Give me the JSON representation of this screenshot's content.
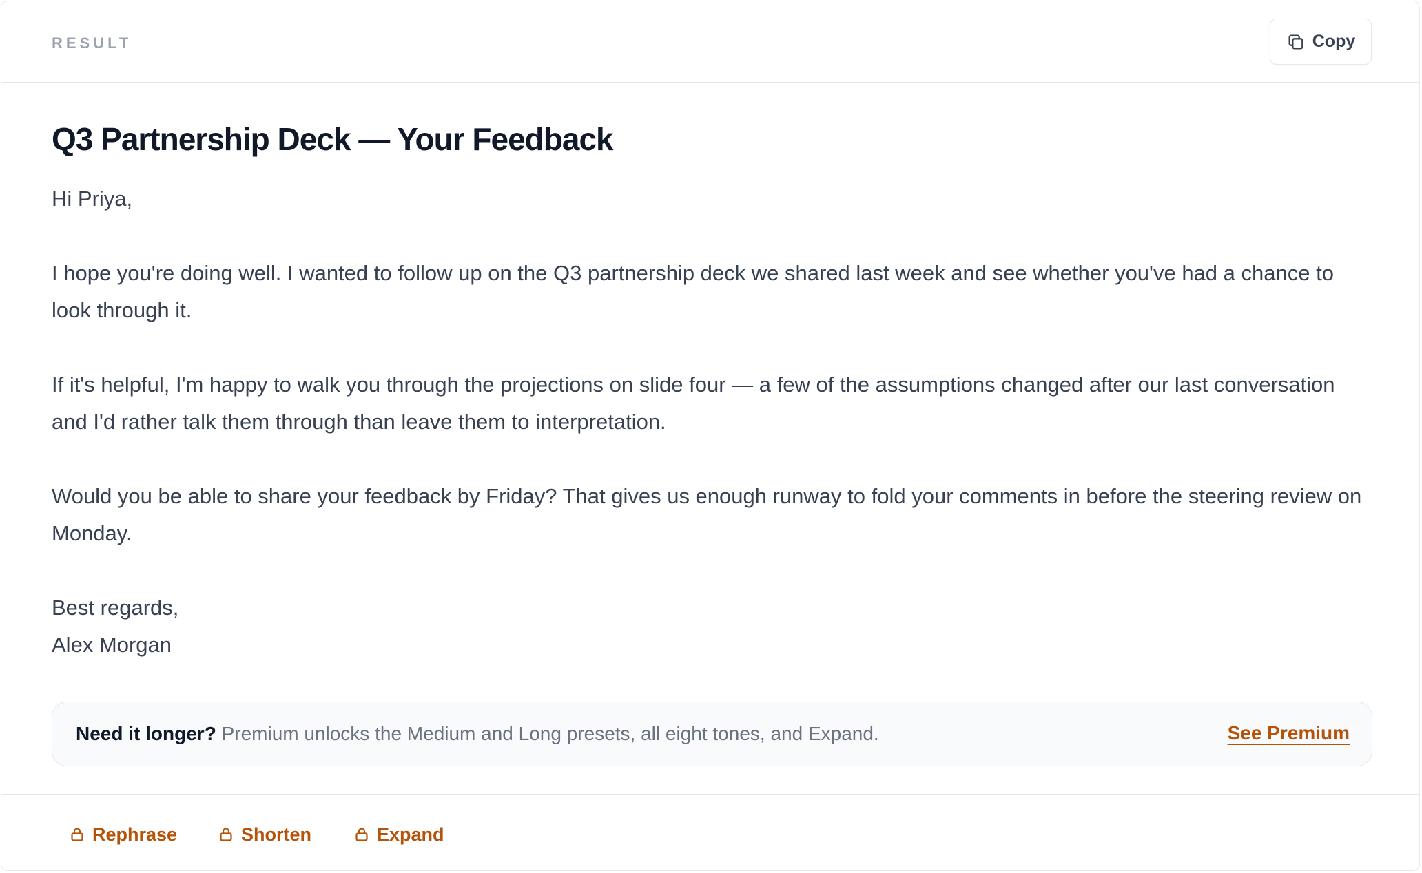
{
  "header": {
    "label": "RESULT",
    "copy_label": "Copy"
  },
  "email": {
    "title": "Q3 Partnership Deck — Your Feedback",
    "greeting": "Hi Priya,",
    "paragraphs": [
      "I hope you're doing well. I wanted to follow up on the Q3 partnership deck we shared last week and see whether you've had a chance to look through it.",
      "If it's helpful, I'm happy to walk you through the projections on slide four — a few of the assumptions changed after our last conversation and I'd rather talk them through than leave them to interpretation.",
      "Would you be able to share your feedback by Friday? That gives us enough runway to fold your comments in before the steering review on Monday."
    ],
    "closing": "Best regards,",
    "signature": "Alex Morgan"
  },
  "upsell": {
    "heading": "Need it longer?",
    "description": "Premium unlocks the Medium and Long presets, all eight tones, and Expand.",
    "cta": "See Premium"
  },
  "actions": [
    {
      "label": "Rephrase",
      "icon": "lock-icon"
    },
    {
      "label": "Shorten",
      "icon": "lock-icon"
    },
    {
      "label": "Expand",
      "icon": "lock-icon"
    }
  ],
  "colors": {
    "accent": "#b45309",
    "title": "#111827",
    "body": "#374151",
    "muted": "#9ca3af",
    "border": "#e5e7eb",
    "upsell_bg": "#f8fafc"
  }
}
